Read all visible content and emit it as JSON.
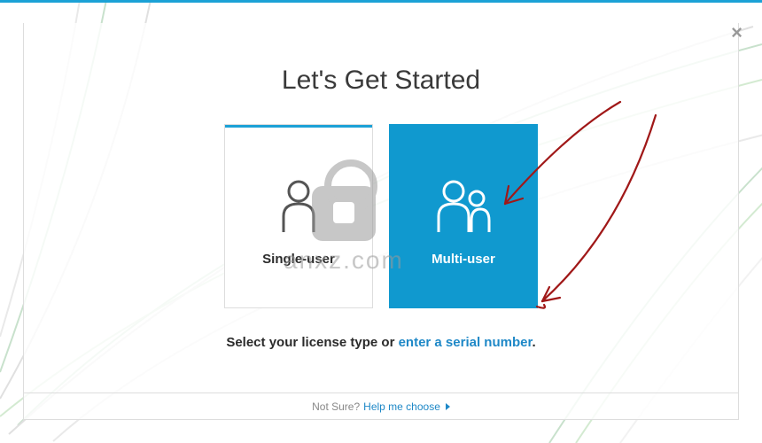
{
  "heading": "Let's Get Started",
  "close_glyph": "×",
  "cards": {
    "single": {
      "label": "Single-user"
    },
    "multi": {
      "label": "Multi-user"
    }
  },
  "subtitle": {
    "prefix": "Select your license type or ",
    "link": "enter a serial number",
    "suffix": "."
  },
  "footer": {
    "prefix": "Not Sure?",
    "link": "Help me choose"
  },
  "watermark": "anxz.com",
  "colors": {
    "accent": "#1ba1d6",
    "selected": "#1099cf",
    "link": "#1e88c7"
  }
}
